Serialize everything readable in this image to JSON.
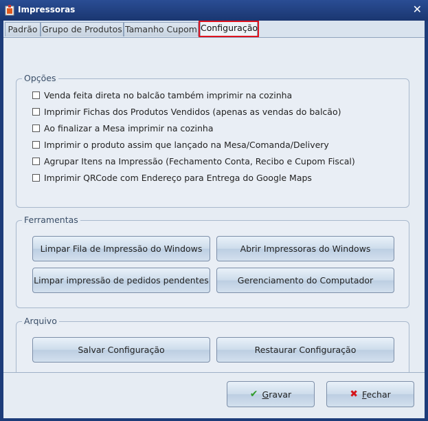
{
  "window": {
    "title": "Impressoras",
    "close_glyph": "✕"
  },
  "tabs": [
    {
      "label": "Padrão"
    },
    {
      "label": "Grupo de Produtos"
    },
    {
      "label": "Tamanho Cupom"
    },
    {
      "label": "Configuração"
    }
  ],
  "opcoes": {
    "legend": "Opções",
    "items": [
      {
        "label": "Venda feita direta no balcão também imprimir na cozinha",
        "checked": false
      },
      {
        "label": "Imprimir Fichas dos Produtos Vendidos (apenas as vendas do balcão)",
        "checked": false
      },
      {
        "label": "Ao finalizar a Mesa imprimir na cozinha",
        "checked": false
      },
      {
        "label": "Imprimir o produto assim que lançado na Mesa/Comanda/Delivery",
        "checked": false
      },
      {
        "label": "Agrupar Itens na Impressão (Fechamento Conta, Recibo e Cupom Fiscal)",
        "checked": false
      },
      {
        "label": "Imprimir QRCode com Endereço para Entrega do Google Maps",
        "checked": false
      }
    ]
  },
  "ferramentas": {
    "legend": "Ferramentas",
    "limpar_fila": "Limpar Fila de Impressão do Windows",
    "abrir_impressoras": "Abrir Impressoras do Windows",
    "limpar_pendentes": "Limpar impressão de pedidos pendentes",
    "gerenciamento": "Gerenciamento do Computador"
  },
  "arquivo": {
    "legend": "Arquivo",
    "salvar": "Salvar Configuração",
    "restaurar": "Restaurar Configuração"
  },
  "footer": {
    "gravar_first": "G",
    "gravar_rest": "ravar",
    "fechar_first": "F",
    "fechar_rest": "echar"
  },
  "icons": {
    "app": "printer-icon",
    "gravar": "checkmark-icon",
    "fechar": "x-icon"
  },
  "colors": {
    "titlebar": "#1d3c79",
    "highlight": "#e0141f",
    "check": "#2f9a2a",
    "close": "#d4141b"
  }
}
